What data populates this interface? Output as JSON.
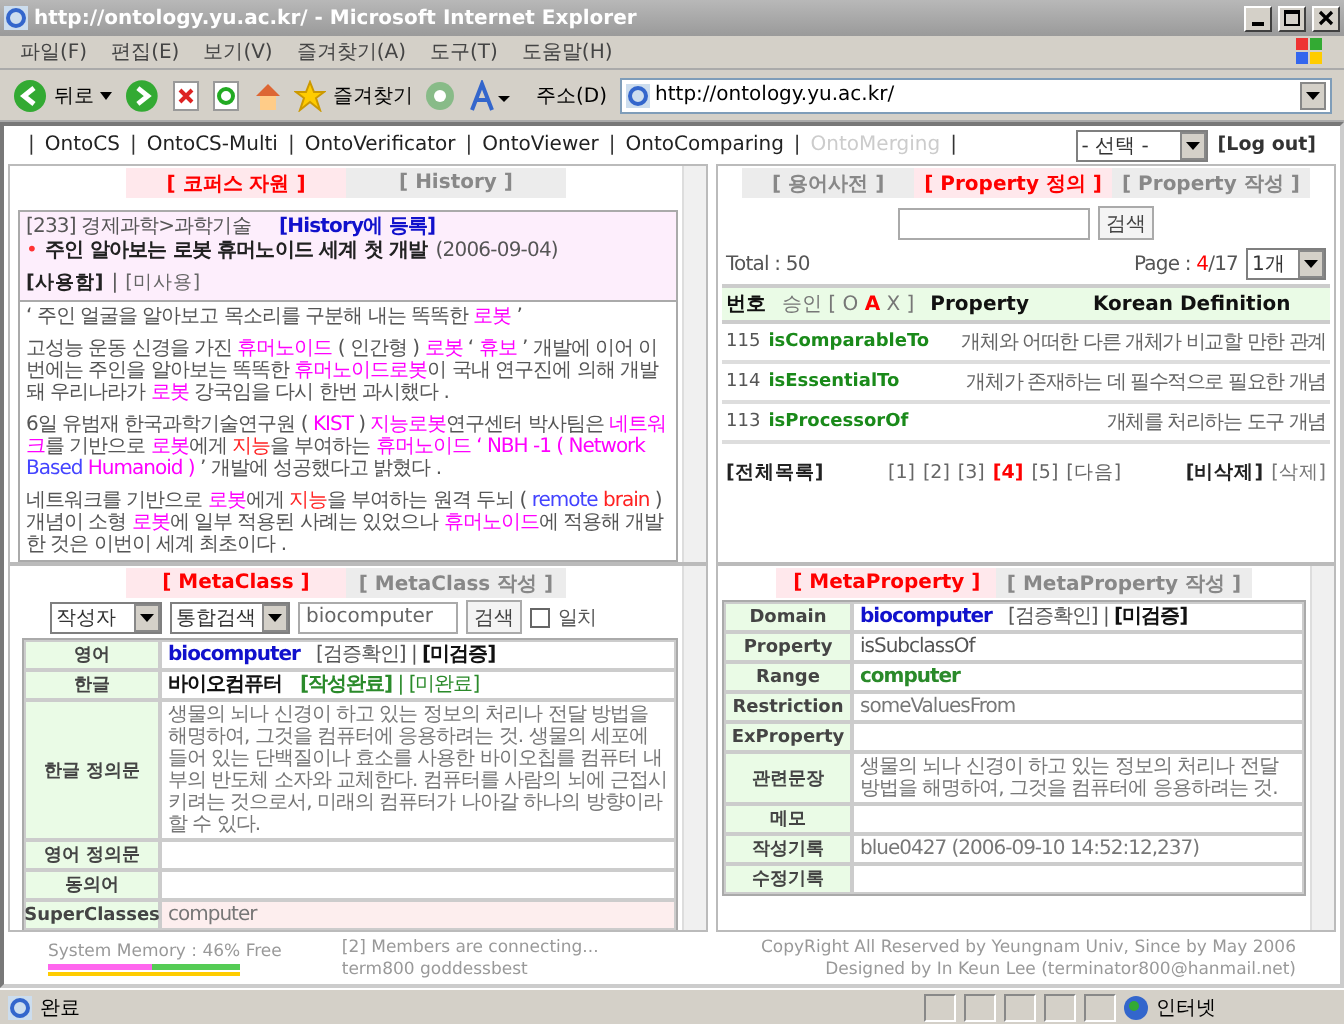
{
  "window": {
    "title": "http://ontology.yu.ac.kr/ - Microsoft Internet Explorer"
  },
  "menu": [
    "파일(F)",
    "편집(E)",
    "보기(V)",
    "즐겨찾기(A)",
    "도구(T)",
    "도움말(H)"
  ],
  "toolbar": {
    "back": "뒤로",
    "favorites": "즐겨찾기",
    "address_label": "주소(D)",
    "address": "http://ontology.yu.ac.kr/"
  },
  "nav": {
    "items": [
      {
        "label": "OntoCS",
        "disabled": false
      },
      {
        "label": "OntoCS-Multi",
        "disabled": false
      },
      {
        "label": "OntoVerificator",
        "disabled": false
      },
      {
        "label": "OntoViewer",
        "disabled": false
      },
      {
        "label": "OntoComparing",
        "disabled": false
      },
      {
        "label": "OntoMerging",
        "disabled": true
      }
    ],
    "separator": "|",
    "select": "- 선택 -",
    "logout": "[Log out]"
  },
  "corpus": {
    "tabs": [
      {
        "label": "[ 코퍼스 자원 ]",
        "selected": true
      },
      {
        "label": "[ History ]",
        "selected": false
      }
    ],
    "path": "[233] 경제과학>과학기술",
    "register": "[History에 등록]",
    "bullet": "•",
    "title": "주인 알아보는 로봇 휴머노이드 세계 첫 개발",
    "date": "(2006-09-04)",
    "use_options": [
      {
        "label": "[사용함]",
        "selected": true
      },
      {
        "label": "[미사용]",
        "selected": false
      }
    ],
    "divider": "|",
    "paragraphs": [
      [
        {
          "text": "‘ 주인 얼굴을 알아보고 목소리를 구분해 내는 똑똑한 ",
          "kind": "plain"
        },
        {
          "text": "로봇",
          "kind": "term"
        },
        {
          "text": " ’",
          "kind": "plain"
        }
      ],
      [
        {
          "text": "고성능 운동 신경을 가진 ",
          "kind": "plain"
        },
        {
          "text": "휴머노이드",
          "kind": "term"
        },
        {
          "text": " ( 인간형 ) ",
          "kind": "plain"
        },
        {
          "text": "로봇",
          "kind": "term"
        },
        {
          "text": " ‘ ",
          "kind": "plain"
        },
        {
          "text": "휴보",
          "kind": "term"
        },
        {
          "text": " ’ 개발에 이어 이번에는 주인을 알아보는 똑똑한 ",
          "kind": "plain"
        },
        {
          "text": "휴머노이드로봇",
          "kind": "term"
        },
        {
          "text": "이 국내 연구진에 의해 개발돼 우리나라가 ",
          "kind": "plain"
        },
        {
          "text": "로봇",
          "kind": "term"
        },
        {
          "text": " 강국임을 다시 한번 과시했다 .",
          "kind": "plain"
        }
      ],
      [
        {
          "text": "6일 유범재 한국과학기술연구원 ( ",
          "kind": "plain"
        },
        {
          "text": "KIST",
          "kind": "term"
        },
        {
          "text": " ) ",
          "kind": "plain"
        },
        {
          "text": "지능로봇",
          "kind": "term"
        },
        {
          "text": "연구센터 박사팀은 ",
          "kind": "plain"
        },
        {
          "text": "네트워크",
          "kind": "term"
        },
        {
          "text": "를 기반으로 ",
          "kind": "plain"
        },
        {
          "text": "로봇",
          "kind": "term"
        },
        {
          "text": "에게 ",
          "kind": "plain"
        },
        {
          "text": "지능",
          "kind": "key"
        },
        {
          "text": "을 부여하는 ",
          "kind": "plain"
        },
        {
          "text": "휴머노이드",
          "kind": "term"
        },
        {
          "text": " ‘ NBH -1 ( Network ",
          "kind": "term"
        },
        {
          "text": "Based",
          "kind": "en"
        },
        {
          "text": " Humanoid ) ",
          "kind": "term"
        },
        {
          "text": "’ 개발에 성공했다고 밝혔다 .",
          "kind": "plain"
        }
      ],
      [
        {
          "text": "네트워크를 기반으로 ",
          "kind": "plain"
        },
        {
          "text": "로봇",
          "kind": "term"
        },
        {
          "text": "에게 ",
          "kind": "plain"
        },
        {
          "text": "지능",
          "kind": "key"
        },
        {
          "text": "을 부여하는 원격 두뇌 ( ",
          "kind": "plain"
        },
        {
          "text": "remote",
          "kind": "en"
        },
        {
          "text": " brain",
          "kind": "key"
        },
        {
          "text": " ) 개념이 소형 ",
          "kind": "plain"
        },
        {
          "text": "로봇",
          "kind": "term"
        },
        {
          "text": "에 일부 적용된 사례는 있었으나 ",
          "kind": "plain"
        },
        {
          "text": "휴머노이드",
          "kind": "term"
        },
        {
          "text": "에 적용해 개발한 것은 이번이 세계 최초이다 .",
          "kind": "plain"
        }
      ]
    ]
  },
  "property": {
    "tabs": [
      {
        "label": "[ 용어사전 ]",
        "selected": false
      },
      {
        "label": "[ Property 정의 ]",
        "selected": true
      },
      {
        "label": "[ Property 작성 ]",
        "selected": false
      }
    ],
    "search_button": "검색",
    "total": "Total : 50",
    "page_label": "Page : ",
    "page_current": "4",
    "page_total": "/17",
    "per_page": "1개",
    "columns": [
      [
        {
          "text": "번호",
          "kind": "bold"
        }
      ],
      [
        {
          "text": "승인 [ O ",
          "kind": "grey"
        },
        {
          "text": "A",
          "kind": "redbold"
        },
        {
          "text": " X ]",
          "kind": "grey"
        }
      ],
      [
        {
          "text": "Property",
          "kind": "bold"
        }
      ],
      [
        {
          "text": "Korean Definition",
          "kind": "bold"
        }
      ]
    ],
    "rows": [
      {
        "number": "115",
        "name": "isComparableTo",
        "definition": "개체와 어떠한 다른 개체가 비교할 만한 관계"
      },
      {
        "number": "114",
        "name": "isEssentialTo",
        "definition": "개체가 존재하는 데 필수적으로 필요한 개념"
      },
      {
        "number": "113",
        "name": "isProcessorOf",
        "definition": "개체를 처리하는 도구 개념"
      }
    ],
    "all_list": "[전체목록]",
    "pages": [
      {
        "label": "[1]",
        "selected": false
      },
      {
        "label": "[2]",
        "selected": false
      },
      {
        "label": "[3]",
        "selected": false
      },
      {
        "label": "[4]",
        "selected": true
      },
      {
        "label": "[5]",
        "selected": false
      }
    ],
    "next": "[다음]",
    "actions": [
      {
        "label": "[비삭제]",
        "selected": true
      },
      {
        "label": "[삭제]",
        "selected": false
      }
    ]
  },
  "metaclass": {
    "tabs": [
      {
        "label": "[ MetaClass ]",
        "selected": true
      },
      {
        "label": "[ MetaClass 작성 ]",
        "selected": false
      }
    ],
    "author_select": "작성자",
    "search_select": "통합검색",
    "query": "biocomputer",
    "search_button": "검색",
    "exact": {
      "label": "일치",
      "checked": false
    },
    "rows": [
      {
        "label": "영어",
        "value": [
          {
            "text": "biocomputer",
            "kind": "link"
          },
          {
            "text": "   [검증확인] | ",
            "kind": "plain"
          },
          {
            "text": "[미검증]",
            "kind": "bold"
          }
        ],
        "highlight": false
      },
      {
        "label": "한글",
        "value": [
          {
            "text": "바이오컴퓨터",
            "kind": "bold"
          },
          {
            "text": "   [작성완료]",
            "kind": "greenbold"
          },
          {
            "text": " | [미완료]",
            "kind": "green"
          }
        ],
        "highlight": false
      },
      {
        "label": "한글 정의문",
        "value": [
          {
            "text": "생물의 뇌나 신경이 하고 있는 정보의 처리나 전달 방법을 해명하여, 그것을 컴퓨터에 응용하려는 것. 생물의 세포에 들어 있는 단백질이나 효소를 사용한 바이오칩를 컴퓨터 내부의 반도체 소자와 교체한다. 컴퓨터를 사람의 뇌에 근접시키려는 것으로서, 미래의 컴퓨터가 나아갈 하나의 방향이라 할 수 있다.",
            "kind": "grey"
          }
        ],
        "highlight": false
      },
      {
        "label": "영어 정의문",
        "value": [],
        "highlight": false
      },
      {
        "label": "동의어",
        "value": [],
        "highlight": false
      },
      {
        "label": "SuperClasses",
        "value": [
          {
            "text": "computer",
            "kind": "grey"
          }
        ],
        "highlight": true
      }
    ]
  },
  "metaproperty": {
    "tabs": [
      {
        "label": "[ MetaProperty ]",
        "selected": true
      },
      {
        "label": "[ MetaProperty 작성 ]",
        "selected": false
      }
    ],
    "rows": [
      {
        "label": "Domain",
        "value": [
          {
            "text": "biocomputer",
            "kind": "link"
          },
          {
            "text": "   [검증확인] | ",
            "kind": "plain"
          },
          {
            "text": "[미검증]",
            "kind": "bold"
          }
        ]
      },
      {
        "label": "Property",
        "value": [
          {
            "text": "isSubclassOf",
            "kind": "plain"
          }
        ]
      },
      {
        "label": "Range",
        "value": [
          {
            "text": "computer",
            "kind": "greenbold"
          }
        ]
      },
      {
        "label": "Restriction",
        "value": [
          {
            "text": "someValuesFrom",
            "kind": "grey"
          }
        ]
      },
      {
        "label": "ExProperty",
        "value": []
      },
      {
        "label": "관련문장",
        "value": [
          {
            "text": "생물의 뇌나 신경이 하고 있는 정보의 처리나 전달 방법을 해명하여, 그것을 컴퓨터에 응용하려는 것.",
            "kind": "grey"
          }
        ]
      },
      {
        "label": "메모",
        "value": []
      },
      {
        "label": "작성기록",
        "value": [
          {
            "text": "blue0427 (2006-09-10 14:52:12,237)",
            "kind": "grey"
          }
        ]
      },
      {
        "label": "수정기록",
        "value": []
      }
    ]
  },
  "footer": {
    "memory_label": "System Memory : 46% Free",
    "memory_used": {
      "level": 0.54
    },
    "members": "[2] Members are connecting...",
    "member_names": "term800 goddessbest",
    "copyright": "CopyRight All Reserved by Yeungnam Univ, Since by May 2006",
    "designer": "Designed by In Keun Lee (terminator800@hanmail.net)"
  },
  "status_bar": {
    "text": "완료",
    "zone": "인터넷"
  }
}
